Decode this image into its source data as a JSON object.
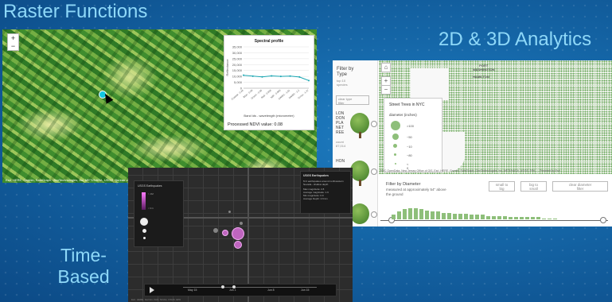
{
  "headings": {
    "raster": "Raster Functions",
    "analytics": "2D & 3D Analytics",
    "time": "Time-\nBased"
  },
  "raster_panel": {
    "zoom_in": "+",
    "zoom_out": "−",
    "attribution": "Esri, HERE, Garmin, SafeGraph, GeoTechnologies, Inc, METI/NASA, USGS, Bureau of Land",
    "spectral_popup": {
      "title": "Spectral profile",
      "ndvi_text": "Processed NDVI value: 0.08",
      "chart_data": {
        "type": "line",
        "title": "Spectral profile",
        "xlabel": "Band ids - wavelength (micrometer)",
        "ylabel": "Reflectance",
        "categories": [
          "Coastal - 0.44",
          "Blue - 0.48",
          "Green - 0.56",
          "Red - 0.655",
          "NIR - 0.865",
          "SWIR1 - 1.61",
          "SWIR2 - 2.2",
          "Cirrus - 1.37"
        ],
        "values": [
          11000,
          10200,
          9600,
          10400,
          10000,
          10300,
          9500,
          6500
        ],
        "ylim": [
          0,
          35000
        ],
        "yticks": [
          "35,000",
          "30,000",
          "25,000",
          "20,000",
          "15,000",
          "10,000",
          "5,000",
          "0"
        ],
        "color": "#1aa6b2",
        "grid": true
      }
    }
  },
  "analytics_panel": {
    "sidebar": {
      "title": "Filter by\nType",
      "subtitle": "top 10\nspecies",
      "clear_label": "clear type\nfilter",
      "species": [
        {
          "name": "LON\nDON\nPLA\nNET\nREE",
          "count": "count\n87,014"
        },
        {
          "name": "HON",
          "count": ""
        }
      ]
    },
    "map": {
      "zoom_in": "+",
      "zoom_out": "−",
      "home": "⌂",
      "labels": {
        "port": "PORT\nWASHINGTON",
        "hamilton": "HAMILTON"
      },
      "legend": {
        "title": "Street Trees in NYC",
        "subtitle": "diameter (inches)",
        "rows": [
          ">100",
          "~50",
          "~10",
          "~80",
          "< 0"
        ]
      },
      "attribution": "NYC OpenData, New Jersey Office of GIS, Esri, HERE, Garmin, SafeGraph, GeoTechnologies, Inc, METI/NASA, USGS, EPA, ...   Powered by Esri"
    },
    "filter": {
      "title": "Filter by Diameter",
      "subtitle": "measured at approximately 54\" above the ground",
      "small_to_big": "small to\nbig",
      "big_to_small": "big to\nsmall",
      "clear": "clear diameter\nfilter"
    },
    "histogram": [
      4,
      7,
      9,
      10,
      10,
      9,
      8,
      7,
      7,
      6,
      6,
      5,
      5,
      5,
      4,
      4,
      4,
      3,
      3,
      3,
      3,
      2,
      2,
      2,
      2,
      2,
      2,
      1,
      1,
      1
    ]
  },
  "time_panel": {
    "legend": {
      "title": "USGS Earthquakes",
      "grad_high": "> 1M",
      "grad_low": "< 0.1"
    },
    "popup": {
      "title": "USGS Earthquakes",
      "lines": [
        "M 2 earthquakes around northwestern",
        "Nevada - shallow depth",
        "Max magnitude: 2.8",
        "Average magnitude: 1.9",
        "Min magnitude: 0.9",
        "Average Depth: 2.6 km"
      ]
    },
    "timeline": {
      "ticks": [
        "May 15",
        "Jun 1",
        "Jun 8",
        "Jun 15"
      ]
    },
    "attribution": "Esri, HERE, Garmin, FAO, NOAA, USGS, EPA"
  }
}
